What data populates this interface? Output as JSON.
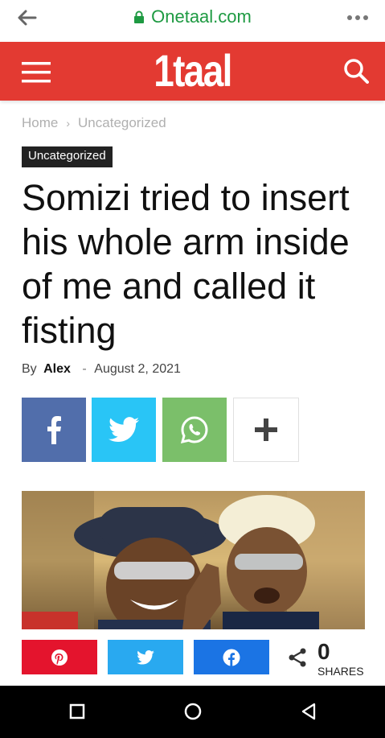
{
  "browser": {
    "url": "Onetaal.com"
  },
  "site": {
    "logo": "1taal"
  },
  "breadcrumb": {
    "home": "Home",
    "separator": "›",
    "current": "Uncategorized"
  },
  "article": {
    "category": "Uncategorized",
    "title": "Somizi tried to insert his whole arm inside of me and called it fisting",
    "by": "By",
    "author": "Alex",
    "dash": "-",
    "date": "August 2, 2021"
  },
  "share_bar": {
    "count": "0",
    "count_label": "SHARES"
  },
  "colors": {
    "brand_red": "#e33a32",
    "facebook": "#516eab",
    "twitter": "#29c5f6",
    "whatsapp": "#7bbf6a",
    "pinterest": "#e4142d"
  }
}
